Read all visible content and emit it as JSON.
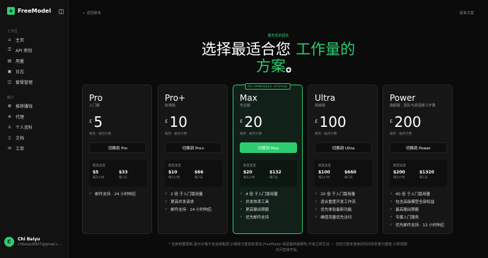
{
  "brand": {
    "name": "FreeModel",
    "logo_glyph": "+",
    "accent": "#2ecc71"
  },
  "sidebar": {
    "section_workspace": "工作区",
    "workspace_items": [
      {
        "label": "主页",
        "icon": "home-icon",
        "glyph": "⌂"
      },
      {
        "label": "API 密钥",
        "icon": "key-icon",
        "glyph": "⚿"
      },
      {
        "label": "用量",
        "icon": "chart-icon",
        "glyph": "▤"
      },
      {
        "label": "日志",
        "icon": "log-icon",
        "glyph": "▣"
      },
      {
        "label": "套餐管理",
        "icon": "plan-icon",
        "glyph": "◫"
      }
    ],
    "section_account": "账户",
    "account_items": [
      {
        "label": "推荐赚钱",
        "icon": "gift-icon",
        "glyph": "✿"
      },
      {
        "label": "代理",
        "icon": "proxy-icon",
        "glyph": "⊕"
      },
      {
        "label": "个人资料",
        "icon": "user-icon",
        "glyph": "♙"
      },
      {
        "label": "文档",
        "icon": "doc-icon",
        "glyph": "▯"
      },
      {
        "label": "工单",
        "icon": "ticket-icon",
        "glyph": "✉"
      }
    ],
    "user": {
      "initial": "C",
      "name": "Chi Baiyu",
      "email": "chibaiyu9907@gmail.c..."
    }
  },
  "header": {
    "back_label": "← 返回账单",
    "contact_label": "联系方案"
  },
  "hero": {
    "kicker": "服务您的团队",
    "title_part1": "选择最适合您",
    "title_highlight": "工作量的",
    "title_part2": "方案",
    "title_end": "。"
  },
  "plans": [
    {
      "name": "Pro",
      "subtitle": "入门版",
      "currency": "£",
      "price": "5",
      "note": "每月 · 按月计费",
      "cta": "切换到 Pro",
      "quota_title": "额度速度",
      "q1_value": "$5",
      "q1_unit": "每5小时",
      "q2_value": "$33",
      "q2_unit": "每7天",
      "features": [
        "邮件支持 · 24 小时响应"
      ]
    },
    {
      "name": "Pro+",
      "subtitle": "标准版",
      "currency": "£",
      "price": "10",
      "note": "每月 · 按月计费",
      "cta": "切换到 Pro+",
      "quota_title": "额度速度",
      "q1_value": "$10",
      "q1_unit": "每5小时",
      "q2_value": "$66",
      "q2_unit": "每7天",
      "features": [
        "2 倍 于入门版用量",
        "更高并发请求",
        "邮件支持 · 24 小时响应"
      ]
    },
    {
      "name": "Max",
      "subtitle": "专业版",
      "currency": "£",
      "price": "20",
      "note": "每月 · 按月计费",
      "cta": "切换到 Max",
      "badge": "RECOMMENDED UPGRADE",
      "quota_title": "额度速度",
      "q1_value": "$20",
      "q1_unit": "每5小时",
      "q2_value": "$132",
      "q2_unit": "每7天",
      "features": [
        "4 倍 于入门版用量",
        "并发效率工具",
        "更高输出限额",
        "优先邮件支持"
      ]
    },
    {
      "name": "Ultra",
      "subtitle": "高级版",
      "currency": "£",
      "price": "100",
      "note": "每月 · 按月计费",
      "cta": "切换到 Ultra",
      "quota_title": "额度速度",
      "q1_value": "$100",
      "q1_unit": "每5小时",
      "q2_value": "$660",
      "q2_unit": "每7天",
      "features": [
        "20 倍 于入门版用量",
        "适合重度开发工作流",
        "优先体验最新功能",
        "峰值流量优先访问"
      ]
    },
    {
      "name": "Power",
      "subtitle": "旗舰版 · 团队与高强度工作量",
      "currency": "£",
      "price": "200",
      "note": "每月 · 按月计费",
      "cta": "切换到 Power",
      "quota_title": "额度速度",
      "q1_value": "$200",
      "q1_unit": "每5小时",
      "q2_value": "$1320",
      "q2_unit": "每7天",
      "features": [
        "40 倍 于入门版用量",
        "包含高级模型全部权益",
        "最高输出限额",
        "专属入门服务",
        "优先邮件支持 · 12 小时响应"
      ]
    }
  ],
  "footnote": "* 选用用量限制,最示价格不含适用税费,价格和方案如有变动,FreeModel 保留最终解释权,升级立即生效 — 当前方案未使用的时间将折算为额度,计费周期次月直接开始。"
}
